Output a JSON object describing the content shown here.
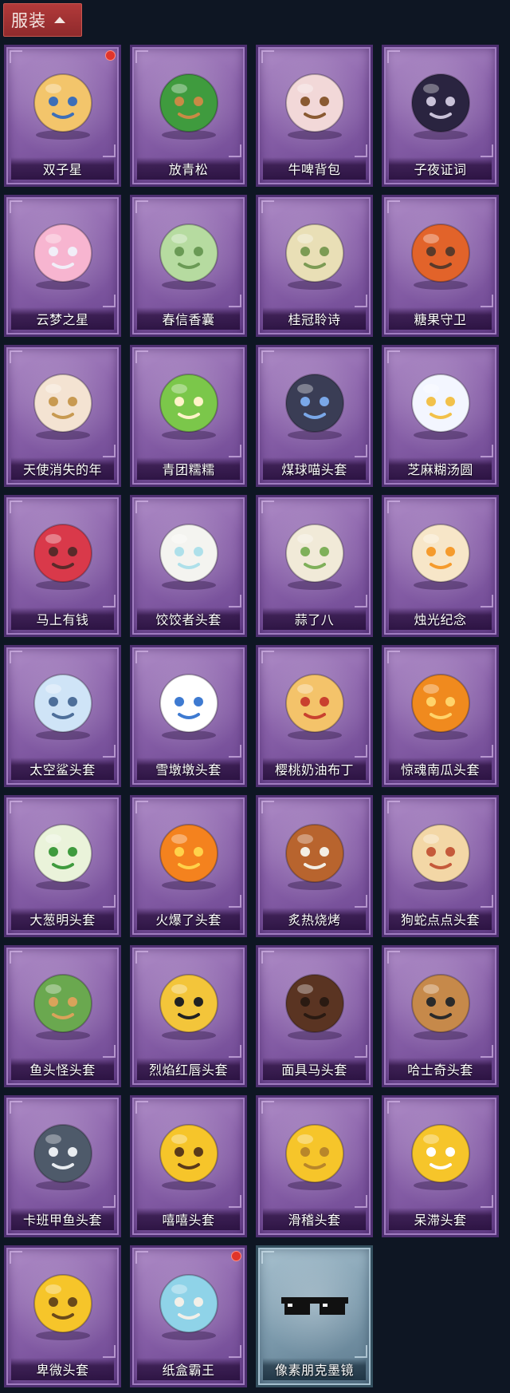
{
  "header": {
    "title": "服装",
    "chevron_icon": "chevron-up-icon"
  },
  "items": [
    {
      "name": "双子星",
      "icon": "twin-star-doll-icon",
      "new": true,
      "rarity": "purple"
    },
    {
      "name": "放青松",
      "icon": "potted-pine-icon",
      "new": false,
      "rarity": "purple"
    },
    {
      "name": "牛啤背包",
      "icon": "cow-beer-backpack-icon",
      "new": false,
      "rarity": "purple"
    },
    {
      "name": "子夜证词",
      "icon": "midnight-owl-icon",
      "new": false,
      "rarity": "purple"
    },
    {
      "name": "云梦之星",
      "icon": "unicorn-cloud-icon",
      "new": false,
      "rarity": "purple"
    },
    {
      "name": "春信香囊",
      "icon": "green-sachet-icon",
      "new": false,
      "rarity": "purple"
    },
    {
      "name": "桂冠聆诗",
      "icon": "laurel-fairy-charm-icon",
      "new": false,
      "rarity": "purple"
    },
    {
      "name": "糖果守卫",
      "icon": "pumpkin-scarecrow-charm-icon",
      "new": false,
      "rarity": "purple"
    },
    {
      "name": "天使消失的年",
      "icon": "angel-girl-icon",
      "new": false,
      "rarity": "purple"
    },
    {
      "name": "青团糯糯",
      "icon": "green-dumpling-head-icon",
      "new": false,
      "rarity": "purple"
    },
    {
      "name": "煤球喵头套",
      "icon": "black-cat-head-icon",
      "new": false,
      "rarity": "purple"
    },
    {
      "name": "芝麻糊汤圆",
      "icon": "rice-ball-head-icon",
      "new": false,
      "rarity": "purple"
    },
    {
      "name": "马上有钱",
      "icon": "red-horse-head-icon",
      "new": false,
      "rarity": "purple"
    },
    {
      "name": "饺饺者头套",
      "icon": "dumpling-head-icon",
      "new": false,
      "rarity": "purple"
    },
    {
      "name": "蒜了八",
      "icon": "garlic-head-icon",
      "new": false,
      "rarity": "purple"
    },
    {
      "name": "烛光纪念",
      "icon": "candle-head-icon",
      "new": false,
      "rarity": "purple"
    },
    {
      "name": "太空鲨头套",
      "icon": "space-shark-head-icon",
      "new": false,
      "rarity": "purple"
    },
    {
      "name": "雪墩墩头套",
      "icon": "snowman-head-icon",
      "new": false,
      "rarity": "purple"
    },
    {
      "name": "樱桃奶油布丁",
      "icon": "cherry-pudding-head-icon",
      "new": false,
      "rarity": "purple"
    },
    {
      "name": "惊魂南瓜头套",
      "icon": "jack-o-lantern-head-icon",
      "new": false,
      "rarity": "purple"
    },
    {
      "name": "大葱明头套",
      "icon": "green-onion-head-icon",
      "new": false,
      "rarity": "purple"
    },
    {
      "name": "火爆了头套",
      "icon": "fire-head-icon",
      "new": false,
      "rarity": "purple"
    },
    {
      "name": "炙热烧烤",
      "icon": "bbq-meat-head-icon",
      "new": false,
      "rarity": "purple"
    },
    {
      "name": "狗蛇点点头套",
      "icon": "snake-head-icon",
      "new": false,
      "rarity": "purple"
    },
    {
      "name": "鱼头怪头套",
      "icon": "fish-monster-head-icon",
      "new": false,
      "rarity": "purple"
    },
    {
      "name": "烈焰红唇头套",
      "icon": "yellow-mouse-head-icon",
      "new": false,
      "rarity": "purple"
    },
    {
      "name": "面具马头套",
      "icon": "horse-mask-head-icon",
      "new": false,
      "rarity": "purple"
    },
    {
      "name": "哈士奇头套",
      "icon": "husky-head-icon",
      "new": false,
      "rarity": "purple"
    },
    {
      "name": "卡班甲鱼头套",
      "icon": "turtle-head-icon",
      "new": false,
      "rarity": "purple"
    },
    {
      "name": "嘻嘻头套",
      "icon": "grin-emoji-head-icon",
      "new": false,
      "rarity": "purple"
    },
    {
      "name": "滑稽头套",
      "icon": "smirk-emoji-head-icon",
      "new": false,
      "rarity": "purple"
    },
    {
      "name": "呆滞头套",
      "icon": "dazed-emoji-head-icon",
      "new": false,
      "rarity": "purple"
    },
    {
      "name": "卑微头套",
      "icon": "humble-emoji-head-icon",
      "new": false,
      "rarity": "purple"
    },
    {
      "name": "纸盒霸王",
      "icon": "cardboard-dino-head-icon",
      "new": true,
      "rarity": "purple"
    },
    {
      "name": "像素朋克墨镜",
      "icon": "pixel-sunglasses-icon",
      "new": false,
      "rarity": "blue"
    }
  ]
}
